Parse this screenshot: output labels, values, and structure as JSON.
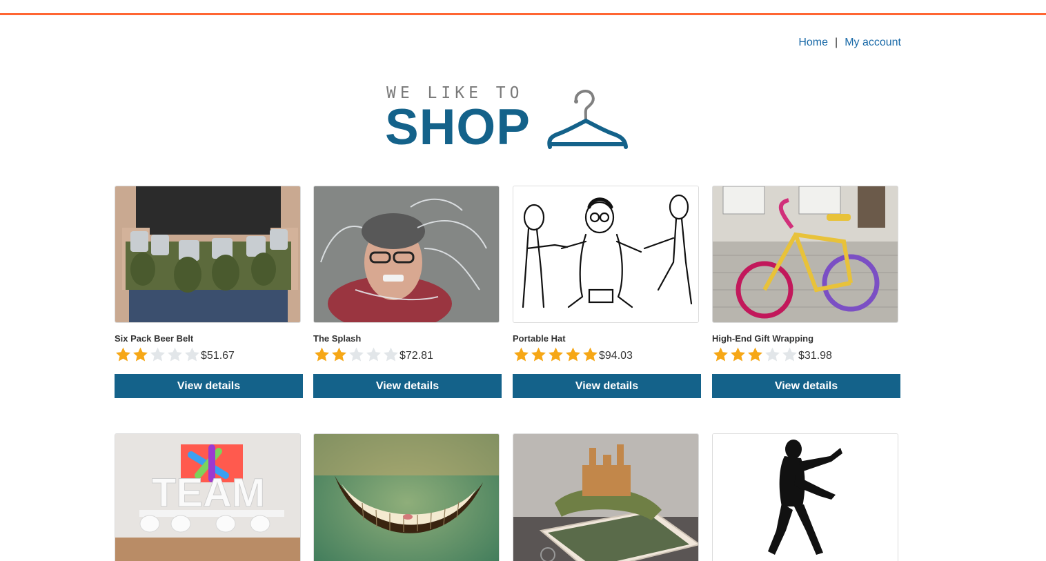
{
  "nav": {
    "home": "Home",
    "separator": "|",
    "account": "My account"
  },
  "logo": {
    "line1": "WE LIKE TO",
    "line2": "SHOP",
    "icon": "hanger-icon"
  },
  "colors": {
    "accent_bar": "#ff6633",
    "brand": "#14628a",
    "link": "#1a6aa8",
    "star_on": "#f6a716",
    "star_off": "#e2e6e9"
  },
  "products": [
    {
      "name": "Six Pack Beer Belt",
      "rating": 2,
      "price": "$51.67",
      "button": "View details"
    },
    {
      "name": "The Splash",
      "rating": 2,
      "price": "$72.81",
      "button": "View details"
    },
    {
      "name": "Portable Hat",
      "rating": 5,
      "price": "$94.03",
      "button": "View details"
    },
    {
      "name": "High-End Gift Wrapping",
      "rating": 3,
      "price": "$31.98",
      "button": "View details"
    }
  ],
  "second_row": [
    {
      "image_text": "TEAM"
    },
    {
      "image_text": ""
    },
    {
      "image_text": ""
    },
    {
      "image_text": ""
    }
  ]
}
